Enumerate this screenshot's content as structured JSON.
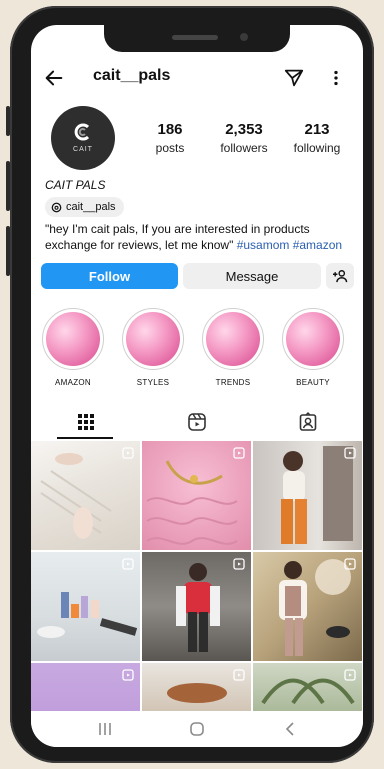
{
  "header": {
    "username": "cait__pals"
  },
  "profile": {
    "avatar_text": "CAIT",
    "display_name": "CAIT PALS",
    "threads_handle": "cait__pals",
    "bio_text": "\"hey I'm cait pals, If you are interested in products exchange for reviews, let me know\"",
    "bio_tags": "#usamom #amazon"
  },
  "stats": [
    {
      "value": "186",
      "label": "posts"
    },
    {
      "value": "2,353",
      "label": "followers"
    },
    {
      "value": "213",
      "label": "following"
    }
  ],
  "actions": {
    "follow_label": "Follow",
    "message_label": "Message"
  },
  "highlights": [
    {
      "label": "AMAZON"
    },
    {
      "label": "STYLES"
    },
    {
      "label": "TRENDS"
    },
    {
      "label": "BEAUTY"
    }
  ],
  "tabs": [
    {
      "icon": "grid-icon",
      "active": true
    },
    {
      "icon": "reels-icon",
      "active": false
    },
    {
      "icon": "tagged-icon",
      "active": false
    }
  ],
  "colors": {
    "follow_button": "#2196f3",
    "hashtag": "#2a5fb0",
    "highlight_pink": "#f59cc6"
  },
  "bottom_nav": [
    {
      "icon": "recent-apps-icon"
    },
    {
      "icon": "home-icon"
    },
    {
      "icon": "back-nav-icon"
    }
  ]
}
